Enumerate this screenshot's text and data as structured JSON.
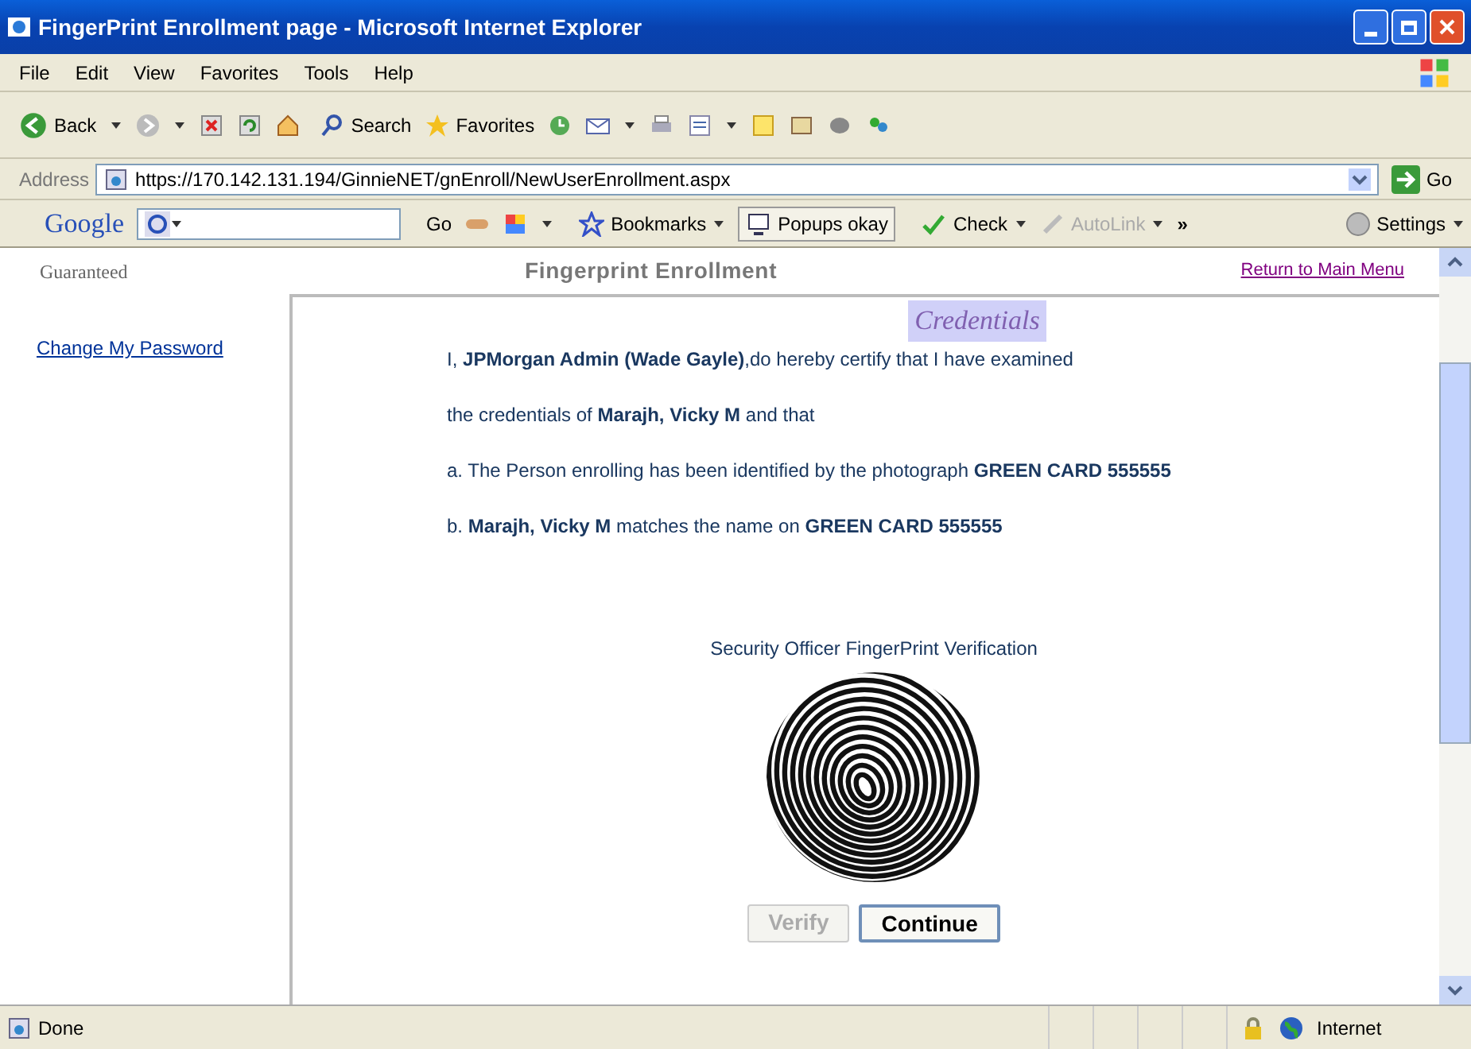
{
  "window": {
    "title": "FingerPrint Enrollment page - Microsoft Internet Explorer"
  },
  "menu": [
    "File",
    "Edit",
    "View",
    "Favorites",
    "Tools",
    "Help"
  ],
  "toolbar": {
    "back": "Back",
    "search": "Search",
    "favorites": "Favorites"
  },
  "address_bar": {
    "label": "Address",
    "url": "https://170.142.131.194/GinnieNET/gnEnroll/NewUserEnrollment.aspx",
    "go": "Go"
  },
  "google_bar": {
    "logo": "Google",
    "go": "Go",
    "bookmarks": "Bookmarks",
    "popups": "Popups okay",
    "check": "Check",
    "autolink": "AutoLink",
    "more": "»",
    "settings": "Settings"
  },
  "sidebar": {
    "logo_text": "Guaranteed",
    "links": [
      "Change My Password"
    ]
  },
  "header": {
    "title": "Fingerprint Enrollment",
    "return_link": "Return to Main Menu"
  },
  "credentials": {
    "heading": "Credentials",
    "lines": [
      "I, **JPMorgan Admin (Wade Gayle)**,do hereby certify that I have examined",
      "the credentials of **Marajh, Vicky M** and that",
      "a. The Person enrolling has been identified by the photograph **GREEN CARD 555555**",
      "b. **Marajh, Vicky M** matches the name on **GREEN CARD 555555**"
    ]
  },
  "verification": {
    "caption": "Security Officer FingerPrint Verification",
    "buttons": [
      {
        "label": "Verify",
        "disabled": true
      },
      {
        "label": "Continue",
        "disabled": false
      }
    ]
  },
  "status_bar": {
    "status": "Done",
    "zone": "Internet"
  }
}
